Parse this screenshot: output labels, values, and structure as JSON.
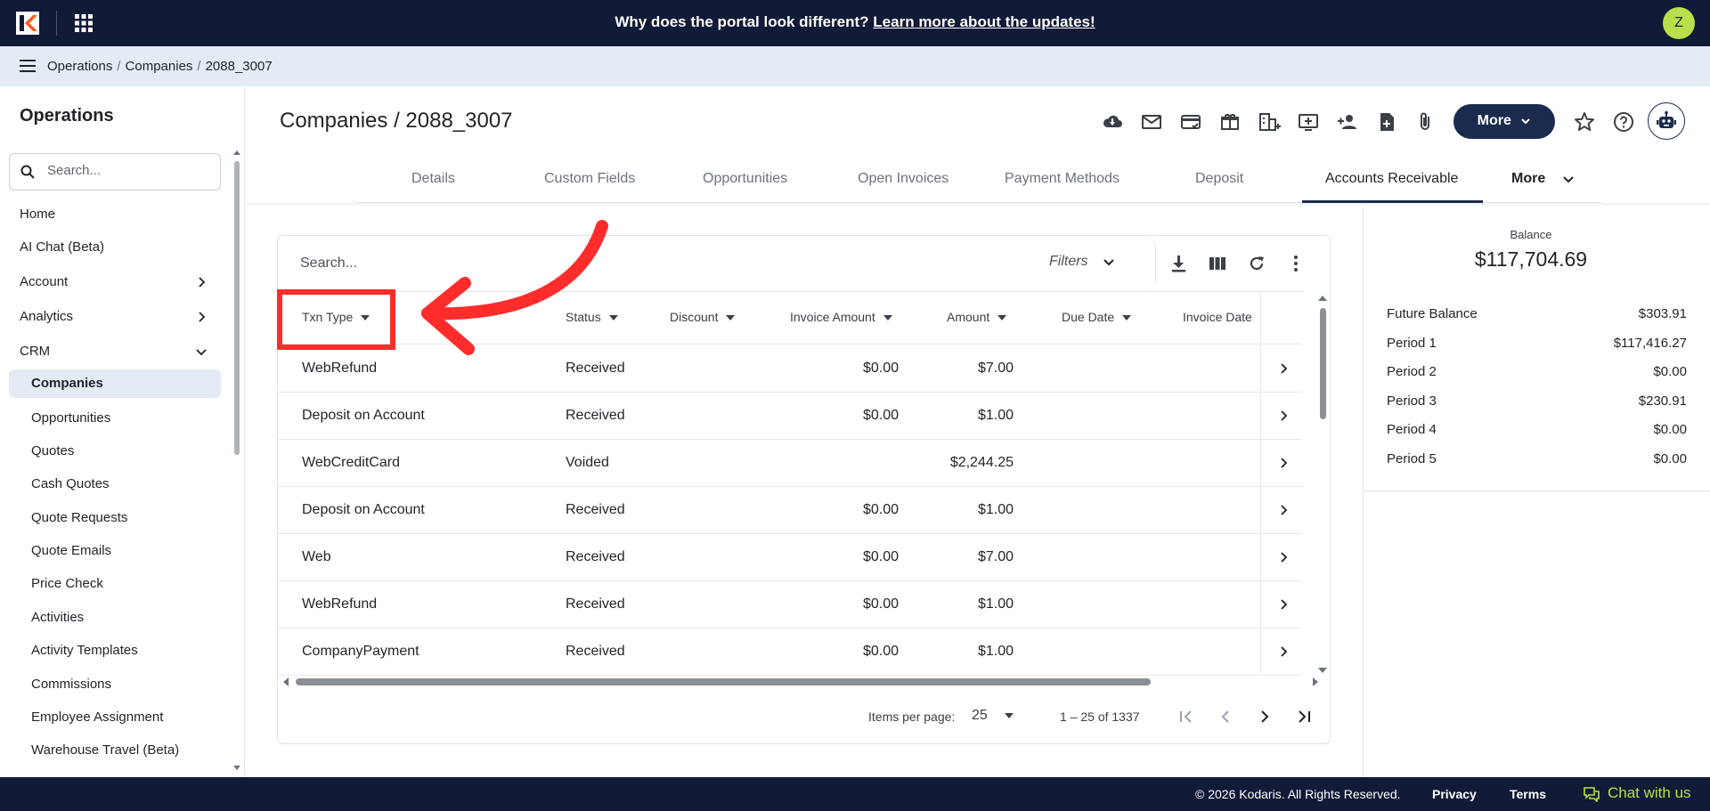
{
  "banner": {
    "message": "Why does the portal look different?",
    "link": "Learn more about the updates!",
    "avatar_initial": "Z"
  },
  "breadcrumb": [
    "Operations",
    "Companies",
    "2088_3007"
  ],
  "sidebar": {
    "title": "Operations",
    "search_placeholder": "Search...",
    "items": [
      {
        "label": "Home",
        "chevron": "none"
      },
      {
        "label": "AI Chat (Beta)",
        "chevron": "none"
      },
      {
        "label": "Account",
        "chevron": "right"
      },
      {
        "label": "Analytics",
        "chevron": "right"
      },
      {
        "label": "CRM",
        "chevron": "down"
      },
      {
        "label": "Companies",
        "active": true
      },
      {
        "label": "Opportunities"
      },
      {
        "label": "Quotes"
      },
      {
        "label": "Cash Quotes"
      },
      {
        "label": "Quote Requests"
      },
      {
        "label": "Quote Emails"
      },
      {
        "label": "Price Check"
      },
      {
        "label": "Activities"
      },
      {
        "label": "Activity Templates"
      },
      {
        "label": "Commissions"
      },
      {
        "label": "Employee Assignment"
      },
      {
        "label": "Warehouse Travel (Beta)"
      }
    ]
  },
  "header": {
    "title": "Companies / 2088_3007",
    "more_label": "More",
    "icons": [
      "cloud-download-icon",
      "mail-icon",
      "credit-card-icon",
      "gift-icon",
      "building-add-icon",
      "add-to-queue-icon",
      "person-add-icon",
      "note-add-icon",
      "attachment-icon"
    ]
  },
  "tabs": {
    "items": [
      "Details",
      "Custom Fields",
      "Opportunities",
      "Open Invoices",
      "Payment Methods",
      "Deposit",
      "Accounts Receivable"
    ],
    "active": "Accounts Receivable",
    "more_label": "More"
  },
  "table": {
    "search_placeholder": "Search...",
    "filters_label": "Filters",
    "columns": [
      "Txn Type",
      "Status",
      "Discount",
      "Invoice Amount",
      "Amount",
      "Due Date",
      "Invoice Date"
    ],
    "rows": [
      {
        "txn_type": "WebRefund",
        "status": "Received",
        "discount": "",
        "invoice_amount": "$0.00",
        "amount": "$7.00"
      },
      {
        "txn_type": "Deposit on Account",
        "status": "Received",
        "discount": "",
        "invoice_amount": "$0.00",
        "amount": "$1.00"
      },
      {
        "txn_type": "WebCreditCard",
        "status": "Voided",
        "discount": "",
        "invoice_amount": "",
        "amount": "$2,244.25"
      },
      {
        "txn_type": "Deposit on Account",
        "status": "Received",
        "discount": "",
        "invoice_amount": "$0.00",
        "amount": "$1.00"
      },
      {
        "txn_type": "Web",
        "status": "Received",
        "discount": "",
        "invoice_amount": "$0.00",
        "amount": "$7.00"
      },
      {
        "txn_type": "WebRefund",
        "status": "Received",
        "discount": "",
        "invoice_amount": "$0.00",
        "amount": "$1.00"
      },
      {
        "txn_type": "CompanyPayment",
        "status": "Received",
        "discount": "",
        "invoice_amount": "$0.00",
        "amount": "$1.00"
      }
    ],
    "pager": {
      "items_per_page_label": "Items per page:",
      "items_per_page": "25",
      "range": "1 – 25 of 1337"
    }
  },
  "balance": {
    "label": "Balance",
    "value": "$117,704.69",
    "rows": [
      {
        "label": "Future Balance",
        "value": "$303.91"
      },
      {
        "label": "Period 1",
        "value": "$117,416.27"
      },
      {
        "label": "Period 2",
        "value": "$0.00"
      },
      {
        "label": "Period 3",
        "value": "$230.91"
      },
      {
        "label": "Period 4",
        "value": "$0.00"
      },
      {
        "label": "Period 5",
        "value": "$0.00"
      }
    ]
  },
  "footer": {
    "copyright": "© 2026 Kodaris. All Rights Reserved.",
    "privacy": "Privacy",
    "terms": "Terms",
    "chat": "Chat with us"
  },
  "colors": {
    "navy": "#111a36",
    "accent": "#1b2b4e",
    "highlight": "#ff2c2c",
    "avatar": "#b8e04a"
  }
}
